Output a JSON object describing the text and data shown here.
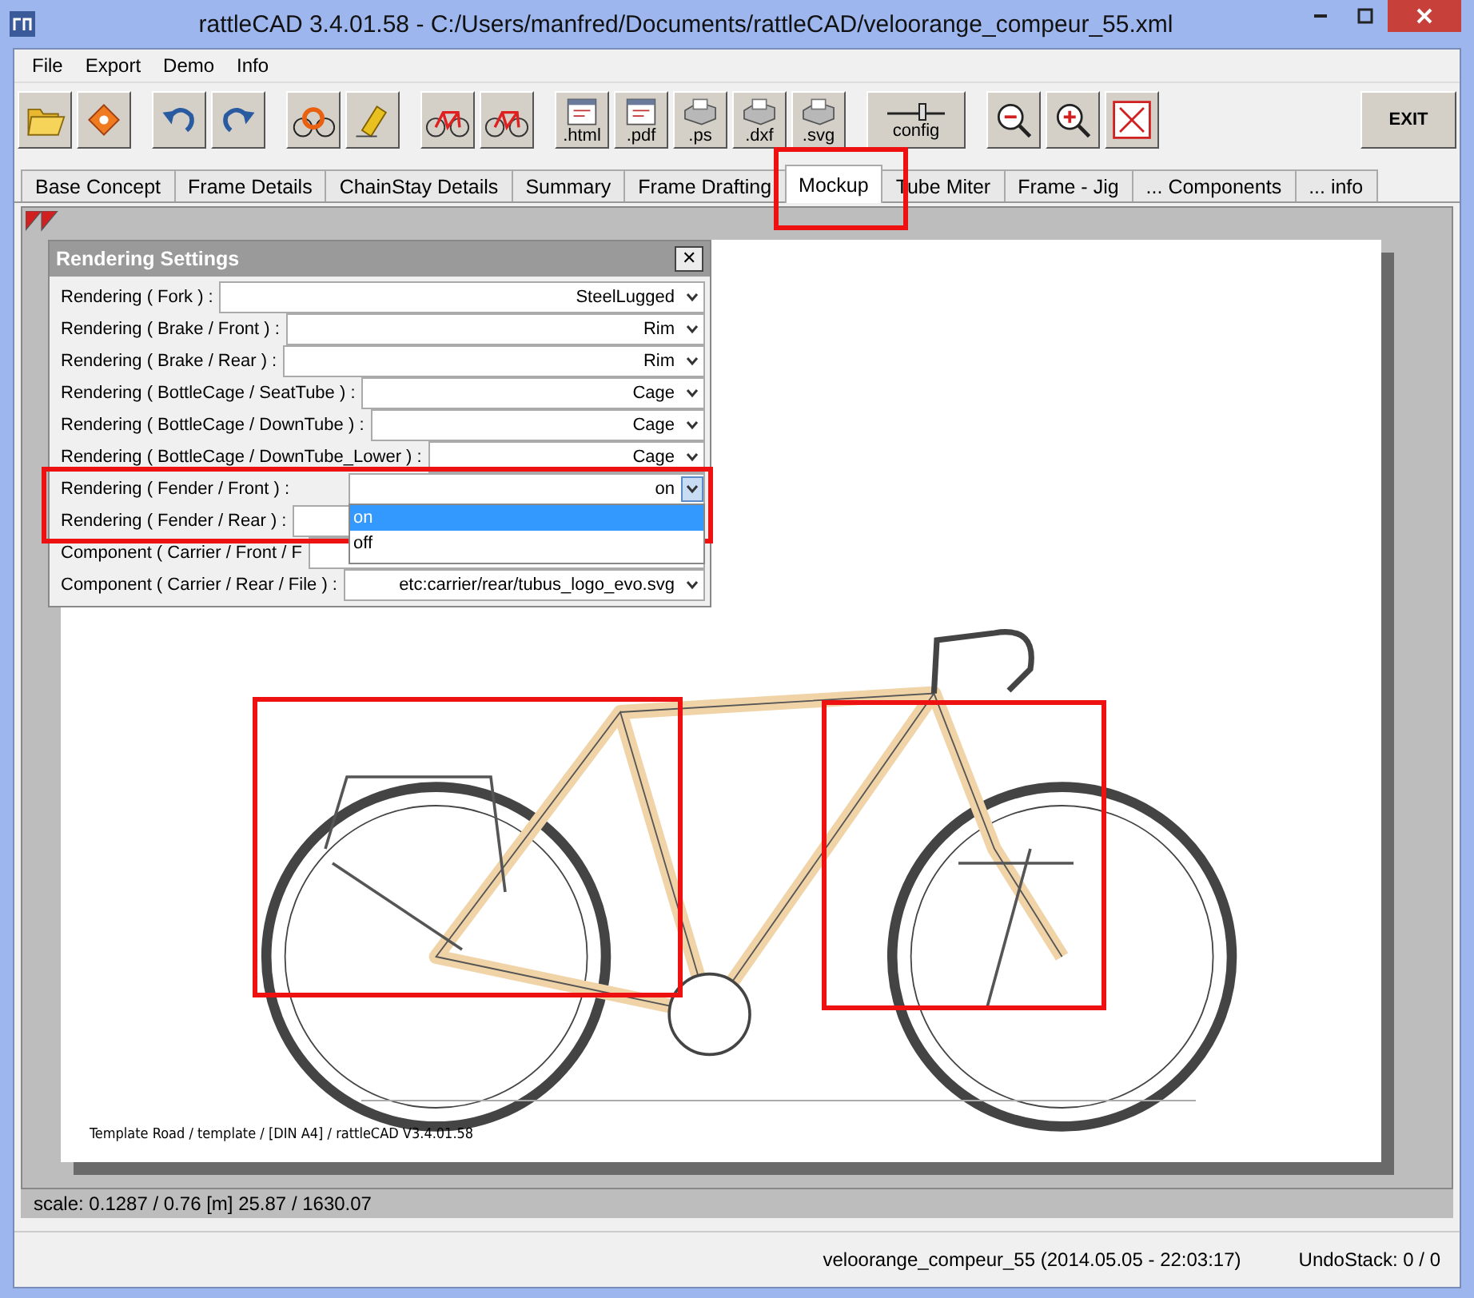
{
  "window": {
    "title": "rattleCAD  3.4.01.58 - C:/Users/manfred/Documents/rattleCAD/veloorange_compeur_55.xml"
  },
  "menu": [
    "File",
    "Export",
    "Demo",
    "Info"
  ],
  "toolbar": [
    {
      "kind": "folder"
    },
    {
      "kind": "disk"
    },
    {
      "kind": "undo"
    },
    {
      "kind": "redo"
    },
    {
      "kind": "bike-gear"
    },
    {
      "kind": "pen"
    },
    {
      "kind": "bike"
    },
    {
      "kind": "bike"
    },
    {
      "kind": "doc",
      "label": ".html"
    },
    {
      "kind": "doc",
      "label": ".pdf"
    },
    {
      "kind": "printer",
      "label": ".ps"
    },
    {
      "kind": "printer",
      "label": ".dxf"
    },
    {
      "kind": "printer",
      "label": ".svg"
    },
    {
      "kind": "config",
      "label": "config"
    },
    {
      "kind": "zoom-out"
    },
    {
      "kind": "zoom-in"
    },
    {
      "kind": "fit"
    },
    {
      "kind": "exit",
      "label": "EXIT"
    }
  ],
  "tabs": [
    {
      "label": "Base Concept",
      "selected": false
    },
    {
      "label": "Frame Details",
      "selected": false
    },
    {
      "label": "ChainStay Details",
      "selected": false
    },
    {
      "label": "Summary",
      "selected": false
    },
    {
      "label": "Frame Drafting",
      "selected": false
    },
    {
      "label": "Mockup",
      "selected": true
    },
    {
      "label": "Tube Miter",
      "selected": false
    },
    {
      "label": "Frame - Jig",
      "selected": false
    },
    {
      "label": "... Components",
      "selected": false
    },
    {
      "label": "... info",
      "selected": false
    }
  ],
  "dialog": {
    "title": "Rendering Settings",
    "close": "✕",
    "rows": [
      {
        "label": "Rendering ( Fork ) :",
        "value": "SteelLugged"
      },
      {
        "label": "Rendering ( Brake / Front ) :",
        "value": "Rim"
      },
      {
        "label": "Rendering ( Brake / Rear ) :",
        "value": "Rim"
      },
      {
        "label": "Rendering ( BottleCage / SeatTube ) :",
        "value": "Cage"
      },
      {
        "label": "Rendering ( BottleCage / DownTube ) :",
        "value": "Cage"
      },
      {
        "label": "Rendering ( BottleCage / DownTube_Lower ) :",
        "value": "Cage"
      },
      {
        "label": "Rendering ( Fender / Front ) :",
        "value": "on",
        "open": true,
        "options": [
          {
            "label": "on",
            "selected": true
          },
          {
            "label": "off",
            "selected": false
          }
        ]
      },
      {
        "label": "Rendering ( Fender / Rear ) :"
      },
      {
        "label": "Component ( Carrier / Front / F"
      },
      {
        "label": "Component ( Carrier / Rear / File ) :",
        "value": "etc:carrier/rear/tubus_logo_evo.svg"
      }
    ]
  },
  "sheet": {
    "caption": "Template Road  /  template  / [DIN A4]  /  rattleCAD  V3.4.01.58"
  },
  "scale": "scale: 0.1287 / 0.76  [m]  25.87 / 1630.07",
  "status_bar": {
    "file": "veloorange_compeur_55 (2014.05.05 - 22:03:17)",
    "undo": "UndoStack:  0 /  0"
  }
}
